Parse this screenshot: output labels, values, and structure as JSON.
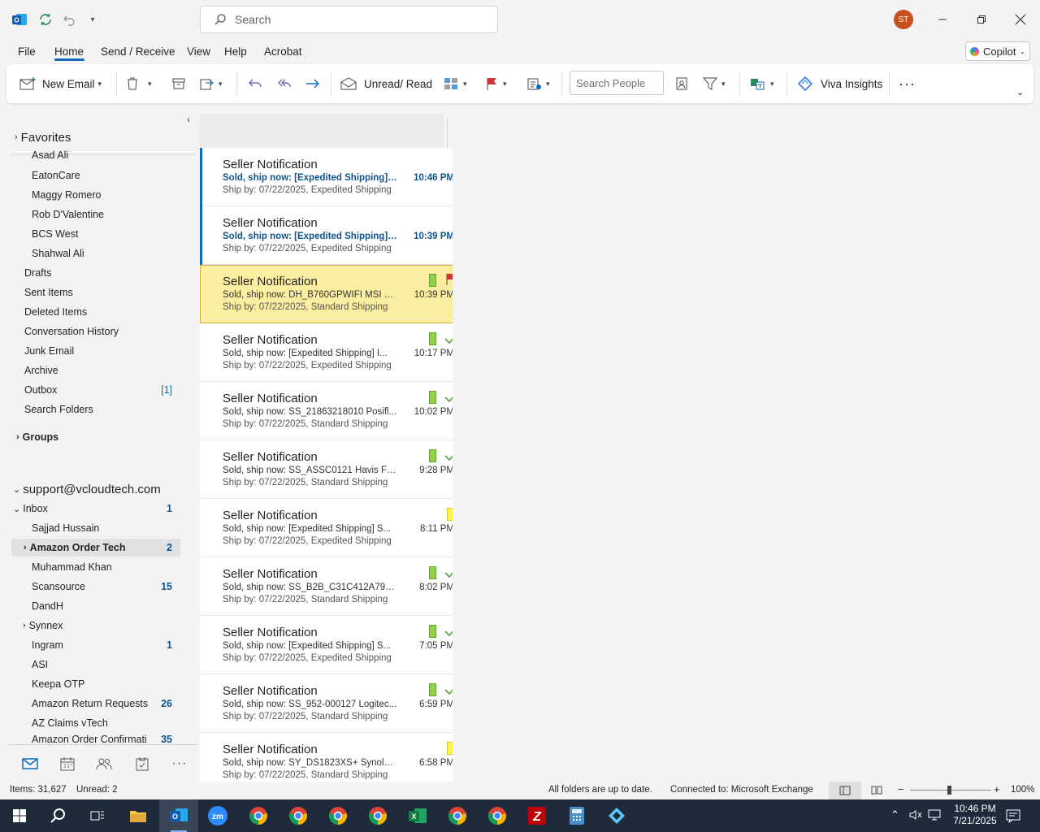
{
  "titlebar": {
    "search_placeholder": "Search",
    "avatar_initials": "ST"
  },
  "menu": {
    "tabs": [
      "File",
      "Home",
      "Send / Receive",
      "View",
      "Help",
      "Acrobat"
    ],
    "active": "Home",
    "copilot_label": "Copilot"
  },
  "ribbon": {
    "new_email": "New Email",
    "unread_read": "Unread/ Read",
    "search_people_placeholder": "Search People",
    "viva_insights": "Viva Insights"
  },
  "folders": {
    "favorites": "Favorites",
    "favorite_items": [
      "Asad Ali",
      "EatonCare",
      "Maggy Romero",
      "Rob D'Valentine",
      "BCS West",
      "Shahwal Ali"
    ],
    "drafts": "Drafts",
    "sent": "Sent Items",
    "deleted": "Deleted Items",
    "conversation_history": "Conversation History",
    "junk": "Junk Email",
    "archive": "Archive",
    "outbox": "Outbox",
    "outbox_count": "[1]",
    "search_folders": "Search Folders",
    "groups": "Groups",
    "account": "support@vcloudtech.com",
    "inbox": "Inbox",
    "inbox_count": "1",
    "inbox_items": [
      {
        "name": "Sajjad Hussain",
        "count": ""
      },
      {
        "name": "Amazon Order Tech",
        "count": "2"
      },
      {
        "name": "Muhammad Khan",
        "count": ""
      },
      {
        "name": "Scansource",
        "count": "15"
      },
      {
        "name": "DandH",
        "count": ""
      },
      {
        "name": "Synnex",
        "count": ""
      },
      {
        "name": "Ingram",
        "count": "1"
      },
      {
        "name": "ASI",
        "count": ""
      },
      {
        "name": "Keepa OTP",
        "count": ""
      },
      {
        "name": "Amazon Return Requests",
        "count": "26"
      },
      {
        "name": "AZ Claims vTech",
        "count": ""
      },
      {
        "name": "Amazon Order Confirmati",
        "count": "35"
      }
    ]
  },
  "messages": [
    {
      "sender": "Seller Notification",
      "subject": "Sold, ship now: [Expedited Shipping] S...",
      "preview": "Ship by: 07/22/2025, Expedited Shipping",
      "time": "10:46 PM",
      "state": "unread"
    },
    {
      "sender": "Seller Notification",
      "subject": "Sold, ship now: [Expedited Shipping] ...",
      "preview": "Ship by: 07/22/2025, Expedited Shipping",
      "time": "10:39 PM",
      "state": "unread"
    },
    {
      "sender": "Seller Notification",
      "subject": "Sold, ship now: DH_B760GPWIFI MSI B7...",
      "preview": "Ship by: 07/22/2025, Standard Shipping",
      "time": "10:39 PM",
      "state": "selected-flagged"
    },
    {
      "sender": "Seller Notification",
      "subject": "Sold, ship now: [Expedited Shipping] I...",
      "preview": "Ship by: 07/22/2025, Expedited Shipping",
      "time": "10:17 PM",
      "state": "done"
    },
    {
      "sender": "Seller Notification",
      "subject": "Sold, ship now: SS_21863218010 Posifl...",
      "preview": "Ship by: 07/22/2025, Standard Shipping",
      "time": "10:02 PM",
      "state": "done"
    },
    {
      "sender": "Seller Notification",
      "subject": "Sold, ship now: SS_ASSC0121 Havis Fle...",
      "preview": "Ship by: 07/22/2025, Standard Shipping",
      "time": "9:28 PM",
      "state": "done"
    },
    {
      "sender": "Seller Notification",
      "subject": "Sold, ship now: [Expedited Shipping] S...",
      "preview": "Ship by: 07/22/2025, Expedited Shipping",
      "time": "8:11 PM",
      "state": "yellow"
    },
    {
      "sender": "Seller Notification",
      "subject": "Sold, ship now: SS_B2B_C31C412A7991 ...",
      "preview": "Ship by: 07/22/2025, Standard Shipping",
      "time": "8:02 PM",
      "state": "done"
    },
    {
      "sender": "Seller Notification",
      "subject": "Sold, ship now: [Expedited Shipping] S...",
      "preview": "Ship by: 07/22/2025, Expedited Shipping",
      "time": "7:05 PM",
      "state": "done"
    },
    {
      "sender": "Seller Notification",
      "subject": "Sold, ship now: SS_952-000127 Logitec...",
      "preview": "Ship by: 07/22/2025, Standard Shipping",
      "time": "6:59 PM",
      "state": "done"
    },
    {
      "sender": "Seller Notification",
      "subject": "Sold, ship now: SY_DS1823XS+ Synolog...",
      "preview": "Ship by: 07/22/2025, Standard Shipping",
      "time": "6:58 PM",
      "state": "yellow"
    }
  ],
  "status": {
    "items": "Items: 31,627",
    "unread": "Unread: 2",
    "sync": "All folders are up to date.",
    "connection": "Connected to: Microsoft Exchange",
    "zoom": "100%"
  },
  "taskbar": {
    "time": "10:46 PM",
    "date": "7/21/2025"
  },
  "colors": {
    "accent": "#0f6cbd",
    "selected_row": "#fbeea0",
    "green_category": "#92d050",
    "yellow_category": "#fff44f",
    "flag": "#d13438"
  }
}
